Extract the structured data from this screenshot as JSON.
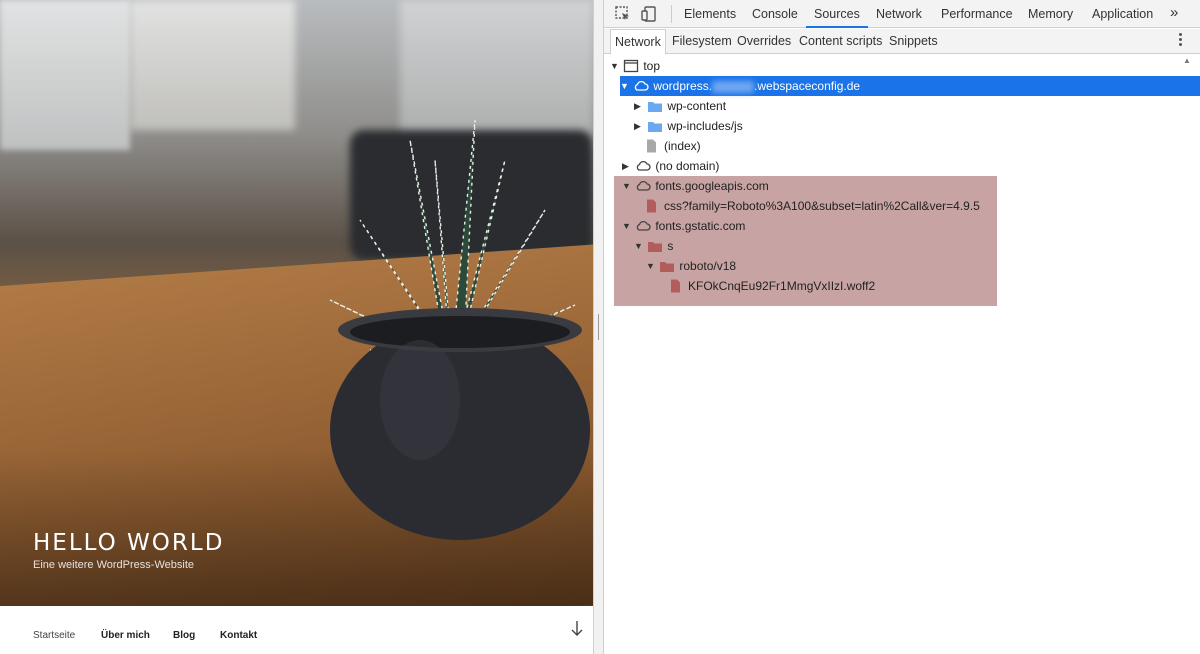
{
  "site": {
    "hero_title": "HELLO WORLD",
    "hero_subtitle": "Eine weitere WordPress-Website",
    "nav": [
      "Startseite",
      "Über mich",
      "Blog",
      "Kontakt"
    ],
    "scroll_icon": "arrow-down-icon"
  },
  "devtools": {
    "toolbar_icons": [
      "inspect-element-icon",
      "device-toolbar-icon"
    ],
    "tabs": [
      "Elements",
      "Console",
      "Sources",
      "Network",
      "Performance",
      "Memory",
      "Application"
    ],
    "active_tab": "Sources",
    "more_tabs": "»",
    "subtabs": [
      "Network",
      "Filesystem",
      "Overrides",
      "Content scripts",
      "Snippets"
    ],
    "active_subtab": "Network",
    "tree": {
      "top": "top",
      "domain_prefix": "wordpress.",
      "domain_suffix": ".webspaceconfig.de",
      "wp_content": "wp-content",
      "wp_includes": "wp-includes/js",
      "index": "(index)",
      "no_domain": "(no domain)",
      "googleapis": "fonts.googleapis.com",
      "css_file": "css?family=Roboto%3A100&subset=latin%2Call&ver=4.9.5",
      "gstatic": "fonts.gstatic.com",
      "folder_s": "s",
      "folder_roboto": "roboto/v18",
      "woff_file": "KFOkCnqEu92Fr1MmgVxIIzI.woff2"
    },
    "colors": {
      "selection": "#1a73e8",
      "highlight": "#c8a3a3",
      "folder_blue": "#6aa9f0",
      "folder_red": "#b35c5c"
    }
  }
}
